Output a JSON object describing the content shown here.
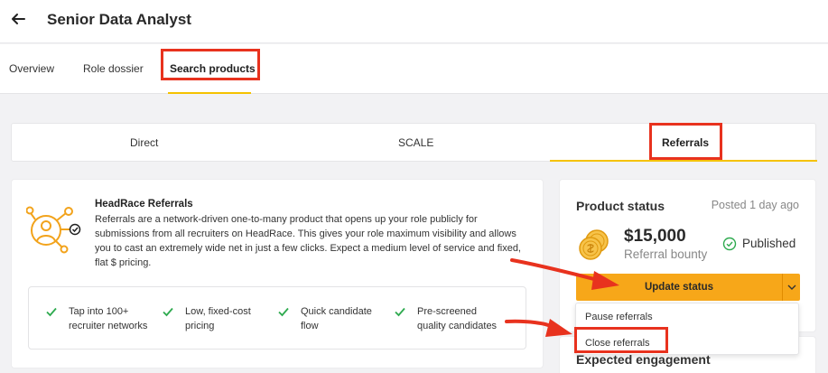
{
  "header": {
    "title": "Senior Data Analyst"
  },
  "tabs": [
    {
      "label": "Overview"
    },
    {
      "label": "Role dossier"
    },
    {
      "label": "Search products",
      "active": true
    }
  ],
  "product_tabs": [
    {
      "label": "Direct"
    },
    {
      "label": "SCALE"
    },
    {
      "label": "Referrals",
      "active": true
    }
  ],
  "info": {
    "title": "HeadRace Referrals",
    "description": "Referrals are a network-driven one-to-many product that opens up your role publicly for submissions from all recruiters on HeadRace. This gives your role maximum visibility and allows you to cast an extremely wide net in just a few clicks. Expect a medium level of service and fixed, flat $ pricing.",
    "features": [
      {
        "line1": "Tap into 100+",
        "line2": "recruiter networks"
      },
      {
        "line1": "Low, fixed-cost",
        "line2": "pricing"
      },
      {
        "line1": "Quick candidate",
        "line2": "flow"
      },
      {
        "line1": "Pre-screened",
        "line2": "quality candidates"
      }
    ]
  },
  "status": {
    "title": "Product status",
    "posted": "Posted 1 day ago",
    "amount": "$15,000",
    "amount_label": "Referral bounty",
    "state": "Published",
    "button_label": "Update status"
  },
  "dropdown": {
    "items": [
      {
        "label": "Pause referrals"
      },
      {
        "label": "Close referrals"
      }
    ]
  },
  "engagement": {
    "title": "Expected engagement"
  },
  "colors": {
    "accent": "#f5c200",
    "button": "#f7a719",
    "highlight": "#e8321e",
    "success": "#2eaa4f",
    "icon_orange": "#f2a31c"
  }
}
